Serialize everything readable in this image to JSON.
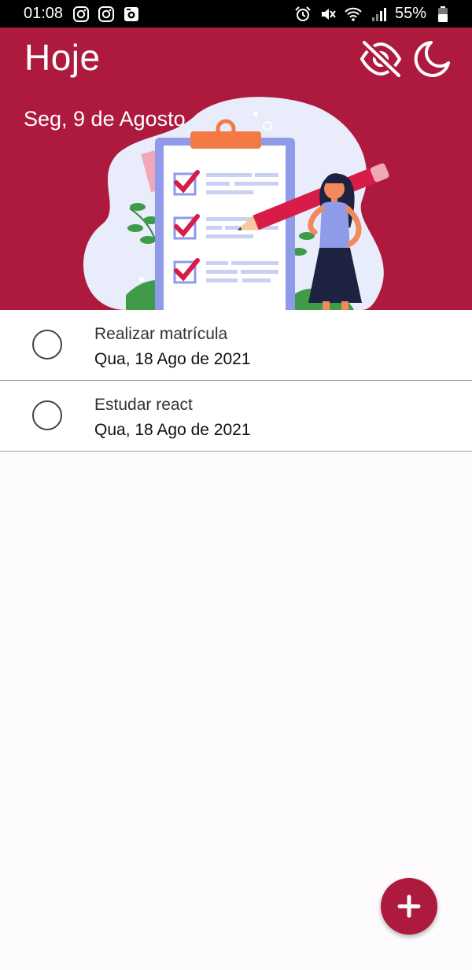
{
  "status_bar": {
    "time": "01:08",
    "battery": "55%",
    "left_icons": [
      "instagram-icon",
      "instagram-icon",
      "notification-app-icon"
    ],
    "right_icons": [
      "alarm-icon",
      "mute-icon",
      "wifi-icon",
      "signal-icon",
      "battery-icon"
    ]
  },
  "header": {
    "title": "Hoje",
    "date": "Seg, 9 de Agosto",
    "background_color": "#ae1a3e",
    "actions": [
      "eye-off-icon",
      "moon-icon"
    ]
  },
  "tasks": [
    {
      "title": "Realizar matrícula",
      "date": "Qua, 18 Ago de 2021",
      "done": false
    },
    {
      "title": "Estudar react",
      "date": "Qua, 18 Ago de 2021",
      "done": false
    }
  ],
  "fab": {
    "icon": "plus-icon",
    "color": "#ae1a3e"
  }
}
